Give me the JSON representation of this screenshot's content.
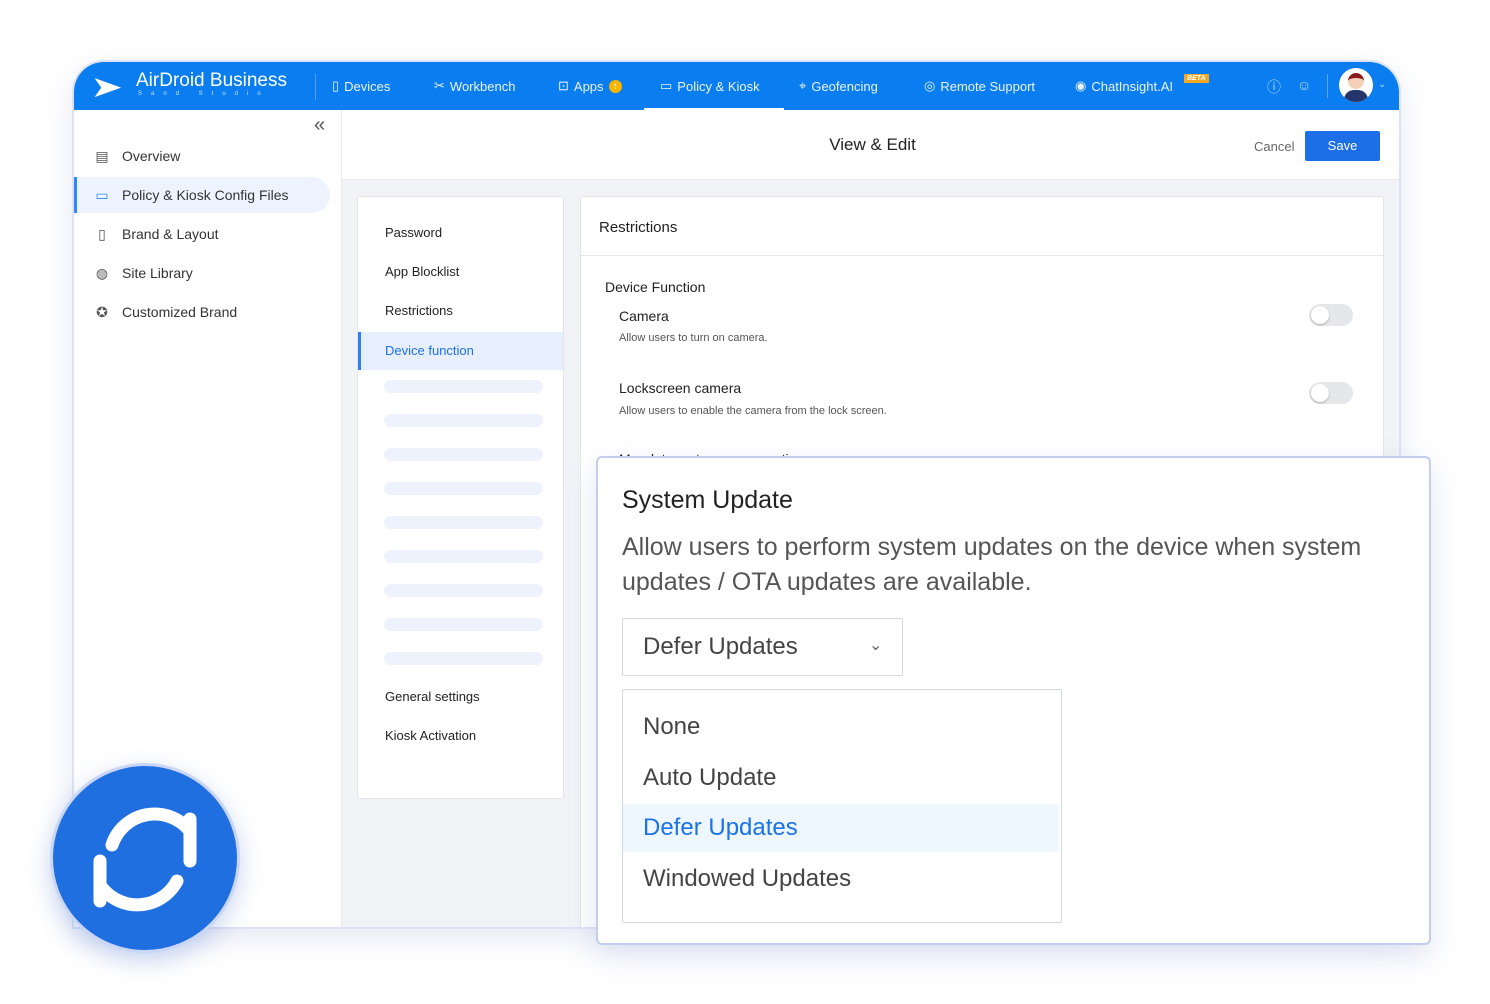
{
  "header": {
    "brand": "AirDroid Business",
    "brand_sub": "Sand Studio",
    "accent": "#0a7ef0",
    "nav": [
      {
        "label": "Devices",
        "icon": "tablet-icon"
      },
      {
        "label": "Workbench",
        "icon": "tools-icon"
      },
      {
        "label": "Apps",
        "icon": "bag-icon"
      },
      {
        "label": "Policy & Kiosk",
        "icon": "folder-icon"
      },
      {
        "label": "Geofencing",
        "icon": "location-icon"
      },
      {
        "label": "Remote Support",
        "icon": "lifebuoy-icon"
      },
      {
        "label": "ChatInsight.AI",
        "icon": "chat-icon"
      }
    ],
    "beta": "BETA"
  },
  "sidebar": {
    "items": [
      {
        "label": "Overview"
      },
      {
        "label": "Policy & Kiosk Config Files"
      },
      {
        "label": "Brand & Layout"
      },
      {
        "label": "Site Library"
      },
      {
        "label": "Customized Brand"
      }
    ]
  },
  "topbar": {
    "title": "View & Edit",
    "cancel": "Cancel",
    "save": "Save"
  },
  "left_menu": {
    "items": [
      "Password",
      "App Blocklist",
      "Restrictions",
      "Device function"
    ],
    "bottom": [
      "General settings",
      "Kiosk Activation"
    ]
  },
  "restrictions": {
    "title": "Restrictions",
    "section": "Device Function",
    "settings": [
      {
        "name": "Camera",
        "desc": "Allow users to turn on camera.",
        "enabled": false
      },
      {
        "name": "Lockscreen camera",
        "desc": "Allow users to enable the camera from the lock screen.",
        "enabled": false
      }
    ],
    "clipped": "Mandatory storage encryption"
  },
  "system_update": {
    "title": "System Update",
    "desc": "Allow users to perform system updates on the device when system updates / OTA updates are available.",
    "selected": "Defer Updates",
    "options": [
      "None",
      "Auto Update",
      "Defer Updates",
      "Windowed Updates"
    ]
  }
}
